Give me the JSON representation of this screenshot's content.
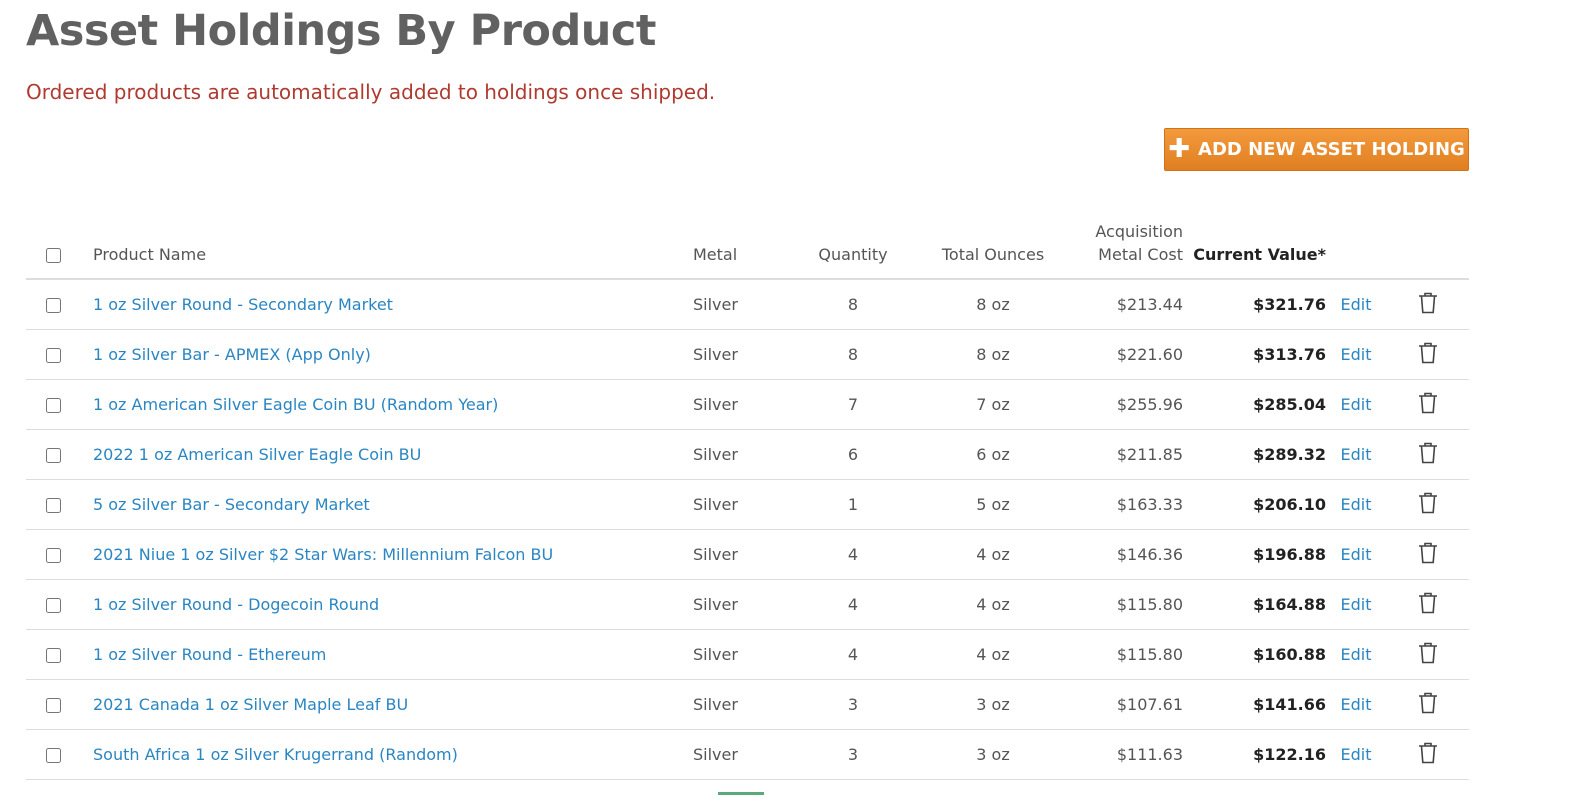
{
  "page": {
    "title": "Asset Holdings By Product",
    "notice": "Ordered products are automatically added to holdings once shipped.",
    "add_button_label": "ADD NEW ASSET HOLDING",
    "add_button_icon": "plus-icon",
    "accent_color": "#e8892c",
    "link_color": "#2a86c2",
    "notice_color": "#b03a30"
  },
  "table": {
    "columns": {
      "product_name": "Product Name",
      "metal": "Metal",
      "quantity": "Quantity",
      "total_ounces": "Total Ounces",
      "acq_line1": "Acquisition",
      "acq_line2": "Metal Cost",
      "current_value": "Current Value*"
    },
    "edit_label": "Edit",
    "delete_icon": "trash-icon",
    "rows": [
      {
        "name": "1 oz Silver Round - Secondary Market",
        "metal": "Silver",
        "qty": "8",
        "oz": "8 oz",
        "cost": "$213.44",
        "value": "$321.76"
      },
      {
        "name": "1 oz Silver Bar - APMEX (App Only)",
        "metal": "Silver",
        "qty": "8",
        "oz": "8 oz",
        "cost": "$221.60",
        "value": "$313.76"
      },
      {
        "name": "1 oz American Silver Eagle Coin BU (Random Year)",
        "metal": "Silver",
        "qty": "7",
        "oz": "7 oz",
        "cost": "$255.96",
        "value": "$285.04"
      },
      {
        "name": "2022 1 oz American Silver Eagle Coin BU",
        "metal": "Silver",
        "qty": "6",
        "oz": "6 oz",
        "cost": "$211.85",
        "value": "$289.32"
      },
      {
        "name": "5 oz Silver Bar - Secondary Market",
        "metal": "Silver",
        "qty": "1",
        "oz": "5 oz",
        "cost": "$163.33",
        "value": "$206.10"
      },
      {
        "name": "2021 Niue 1 oz Silver $2 Star Wars: Millennium Falcon BU",
        "metal": "Silver",
        "qty": "4",
        "oz": "4 oz",
        "cost": "$146.36",
        "value": "$196.88"
      },
      {
        "name": "1 oz Silver Round - Dogecoin Round",
        "metal": "Silver",
        "qty": "4",
        "oz": "4 oz",
        "cost": "$115.80",
        "value": "$164.88"
      },
      {
        "name": "1 oz Silver Round - Ethereum",
        "metal": "Silver",
        "qty": "4",
        "oz": "4 oz",
        "cost": "$115.80",
        "value": "$160.88"
      },
      {
        "name": "2021 Canada 1 oz Silver Maple Leaf BU",
        "metal": "Silver",
        "qty": "3",
        "oz": "3 oz",
        "cost": "$107.61",
        "value": "$141.66"
      },
      {
        "name": "South Africa 1 oz Silver Krugerrand (Random)",
        "metal": "Silver",
        "qty": "3",
        "oz": "3 oz",
        "cost": "$111.63",
        "value": "$122.16"
      }
    ]
  }
}
